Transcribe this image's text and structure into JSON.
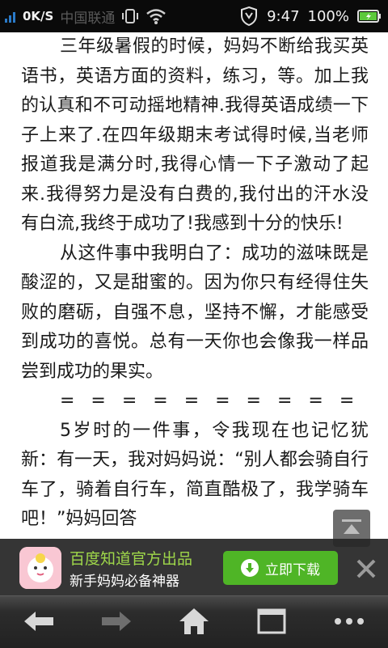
{
  "status_bar": {
    "net_speed": "0K/S",
    "carrier": "中国联通",
    "time": "9:47",
    "battery": "100%"
  },
  "article": {
    "paragraphs": [
      "三年级暑假的时候，妈妈不断给我买英语书，英语方面的资料，练习，等。加上我的认真和不可动摇地精神.我得英语成绩一下子上来了.在四年级期末考试得时候,当老师报道我是满分时,我得心情一下子激动了起来.我得努力是没有白费的,我付出的汗水没有白流,我终于成功了!我感到十分的快乐!",
      "从这件事中我明白了：成功的滋味既是酸涩的，又是甜蜜的。因为你只有经得住失败的磨砺，自强不息，坚持不懈，才能感受到成功的喜悦。总有一天你也会像我一样品尝到成功的果实。",
      "= = = = = = = = = = = = = = = = = = = = = = = = = = = = = = = = = = = = = =",
      "5岁时的一件事，令我现在也记忆犹新：有一天，我对妈妈说：“别人都会骑自行车了，骑着自行车，简直酷极了，我学骑车吧！”妈妈回答"
    ]
  },
  "ad": {
    "title": "百度知道官方出品",
    "subtitle": "新手妈妈必备神器",
    "download_label": "立即下载"
  },
  "toolbar": {
    "icons": [
      "back-icon",
      "forward-icon",
      "home-icon",
      "windows-icon",
      "menu-icon"
    ]
  },
  "colors": {
    "status_bg": "#0a0a0a",
    "ad_title": "#9fd84a",
    "ad_button": "#4fb526",
    "toolbar_bg": "#2c2c2c"
  }
}
